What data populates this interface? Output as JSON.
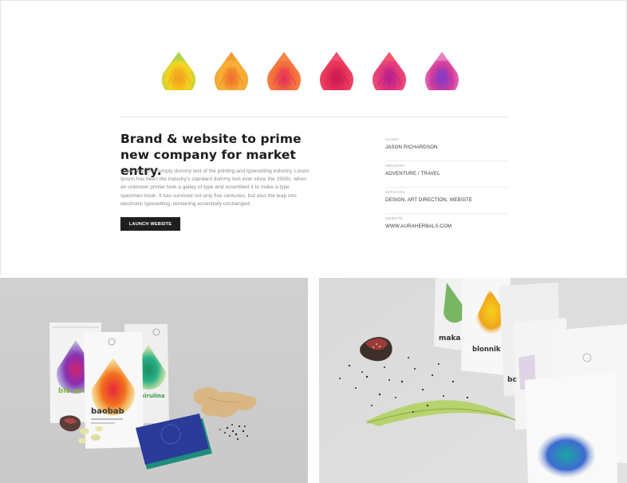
{
  "drops": [
    {
      "name": "drop-icon-yellow-orange",
      "c1": "#f4d320",
      "c2": "#f39a1c",
      "top": "#a9d64a"
    },
    {
      "name": "drop-icon-orange",
      "c1": "#f7b233",
      "c2": "#f06a2c",
      "top": "#f29a3a"
    },
    {
      "name": "drop-icon-red-orange",
      "c1": "#f4703a",
      "c2": "#e32d5d",
      "top": "#f58a4a"
    },
    {
      "name": "drop-icon-crimson",
      "c1": "#e8345a",
      "c2": "#c81a50",
      "top": "#f0506a"
    },
    {
      "name": "drop-icon-magenta",
      "c1": "#e53b7a",
      "c2": "#b51e8e",
      "top": "#f05a6a"
    },
    {
      "name": "drop-icon-purple",
      "c1": "#d43c9a",
      "c2": "#7c3ac8",
      "top": "#e886c0"
    }
  ],
  "project": {
    "headline": "Brand & website to prime new company for market entry.",
    "body": "Lorem Ipsum is simply dummy text of the printing and typesetting industry. Lorem Ipsum has been the industry's standard dummy text ever since the 1500s, when an unknown printer took a galley of type and scrambled it to make a type specimen book. It has survived not only five centuries, but also the leap into electronic typesetting, remaining essentially unchanged.",
    "launch_label": "LAUNCH WEBSITE"
  },
  "meta": [
    {
      "label": "CLIENT",
      "value": "JASON RICHARDSON"
    },
    {
      "label": "INDUSTRY",
      "value": "ADVENTURE / TRAVEL"
    },
    {
      "label": "SERVICES",
      "value": "DESIGN, ART DIRECTION, WEBSITE"
    },
    {
      "label": "WEBSITE",
      "value": "WWW.AURAHERBALS.COM"
    }
  ],
  "packages": {
    "acai": "bio acai",
    "baobab": "baobab",
    "spirulina": "spirulina",
    "maka": "maka ko",
    "blonnik": "blonnik",
    "partial": "bc"
  }
}
